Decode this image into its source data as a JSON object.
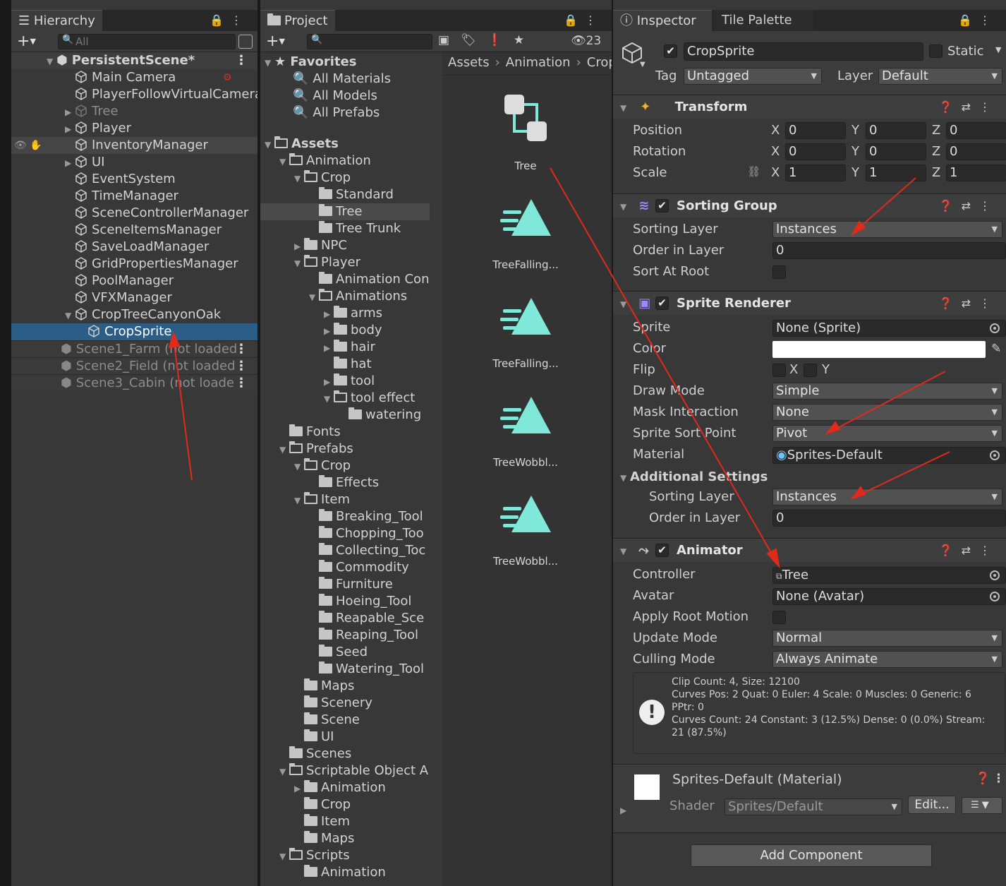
{
  "hierarchy": {
    "tab": "Hierarchy",
    "search_placeholder": "All",
    "scene": "PersistentScene*",
    "items": [
      {
        "label": "Main Camera",
        "indent": 1
      },
      {
        "label": "PlayerFollowVirtualCamera",
        "indent": 1
      },
      {
        "label": "Tree",
        "indent": 1,
        "dim": true,
        "arrow": true
      },
      {
        "label": "Player",
        "indent": 1,
        "arrow": true
      },
      {
        "label": "InventoryManager",
        "indent": 1,
        "hl": true
      },
      {
        "label": "UI",
        "indent": 1,
        "arrow": true
      },
      {
        "label": "EventSystem",
        "indent": 1
      },
      {
        "label": "TimeManager",
        "indent": 1
      },
      {
        "label": "SceneControllerManager",
        "indent": 1
      },
      {
        "label": "SceneItemsManager",
        "indent": 1
      },
      {
        "label": "SaveLoadManager",
        "indent": 1
      },
      {
        "label": "GridPropertiesManager",
        "indent": 1
      },
      {
        "label": "PoolManager",
        "indent": 1
      },
      {
        "label": "VFXManager",
        "indent": 1
      },
      {
        "label": "CropTreeCanyonOak",
        "indent": 1,
        "open": true
      },
      {
        "label": "CropSprite",
        "indent": 2,
        "sel": true
      }
    ],
    "scenes": [
      "Scene1_Farm (not loaded",
      "Scene2_Field (not loaded",
      "Scene3_Cabin (not loade"
    ]
  },
  "project": {
    "tab": "Project",
    "count": "23",
    "favorites": "Favorites",
    "fav_items": [
      "All Materials",
      "All Models",
      "All Prefabs"
    ],
    "tree": [
      {
        "label": "Assets",
        "d": 0,
        "open": true,
        "bold": true
      },
      {
        "label": "Animation",
        "d": 1,
        "open": true
      },
      {
        "label": "Crop",
        "d": 2,
        "open": true
      },
      {
        "label": "Standard",
        "d": 3
      },
      {
        "label": "Tree",
        "d": 3,
        "sel": true
      },
      {
        "label": "Tree Trunk",
        "d": 3
      },
      {
        "label": "NPC",
        "d": 2,
        "arrow": true
      },
      {
        "label": "Player",
        "d": 2,
        "open": true
      },
      {
        "label": "Animation Con",
        "d": 3
      },
      {
        "label": "Animations",
        "d": 3,
        "open": true
      },
      {
        "label": "arms",
        "d": 4,
        "arrow": true
      },
      {
        "label": "body",
        "d": 4,
        "arrow": true
      },
      {
        "label": "hair",
        "d": 4,
        "arrow": true
      },
      {
        "label": "hat",
        "d": 4
      },
      {
        "label": "tool",
        "d": 4,
        "arrow": true
      },
      {
        "label": "tool effect",
        "d": 4,
        "open": true
      },
      {
        "label": "watering",
        "d": 5
      },
      {
        "label": "Fonts",
        "d": 1
      },
      {
        "label": "Prefabs",
        "d": 1,
        "open": true
      },
      {
        "label": "Crop",
        "d": 2,
        "open": true
      },
      {
        "label": "Effects",
        "d": 3
      },
      {
        "label": "Item",
        "d": 2,
        "open": true
      },
      {
        "label": "Breaking_Tool",
        "d": 3
      },
      {
        "label": "Chopping_Too",
        "d": 3
      },
      {
        "label": "Collecting_Toc",
        "d": 3
      },
      {
        "label": "Commodity",
        "d": 3
      },
      {
        "label": "Furniture",
        "d": 3
      },
      {
        "label": "Hoeing_Tool",
        "d": 3
      },
      {
        "label": "Reapable_Sce",
        "d": 3
      },
      {
        "label": "Reaping_Tool",
        "d": 3
      },
      {
        "label": "Seed",
        "d": 3
      },
      {
        "label": "Watering_Tool",
        "d": 3
      },
      {
        "label": "Maps",
        "d": 2
      },
      {
        "label": "Scenery",
        "d": 2
      },
      {
        "label": "Scene",
        "d": 2
      },
      {
        "label": "UI",
        "d": 2
      },
      {
        "label": "Scenes",
        "d": 1
      },
      {
        "label": "Scriptable Object A",
        "d": 1,
        "open": true
      },
      {
        "label": "Animation",
        "d": 2,
        "arrow": true
      },
      {
        "label": "Crop",
        "d": 2
      },
      {
        "label": "Item",
        "d": 2
      },
      {
        "label": "Maps",
        "d": 2
      },
      {
        "label": "Scripts",
        "d": 1,
        "open": true
      },
      {
        "label": "Animation",
        "d": 2
      }
    ],
    "breadcrumb": [
      "Assets",
      "Animation",
      "Crop"
    ],
    "assets": [
      "Tree",
      "TreeFalling...",
      "TreeFalling...",
      "TreeWobbl...",
      "TreeWobbl..."
    ],
    "accent": "#7fe8d8"
  },
  "inspector": {
    "tab": "Inspector",
    "tab2": "Tile Palette",
    "name": "CropSprite",
    "static": "Static",
    "tag_label": "Tag",
    "tag": "Untagged",
    "layer_label": "Layer",
    "layer": "Default",
    "transform": {
      "title": "Transform",
      "rows": [
        {
          "label": "Position",
          "x": "0",
          "y": "0",
          "z": "0"
        },
        {
          "label": "Rotation",
          "x": "0",
          "y": "0",
          "z": "0"
        },
        {
          "label": "Scale",
          "x": "1",
          "y": "1",
          "z": "1"
        }
      ]
    },
    "sorting": {
      "title": "Sorting Group",
      "sorting_layer_label": "Sorting Layer",
      "sorting_layer": "Instances",
      "order_label": "Order in Layer",
      "order": "0",
      "root_label": "Sort At Root"
    },
    "renderer": {
      "title": "Sprite Renderer",
      "sprite_label": "Sprite",
      "sprite": "None (Sprite)",
      "color_label": "Color",
      "flip_label": "Flip",
      "draw_label": "Draw Mode",
      "draw": "Simple",
      "mask_label": "Mask Interaction",
      "mask": "None",
      "sortpoint_label": "Sprite Sort Point",
      "sortpoint": "Pivot",
      "material_label": "Material",
      "material": "Sprites-Default",
      "additional": "Additional Settings",
      "sl_label": "Sorting Layer",
      "sl": "Instances",
      "ol_label": "Order in Layer",
      "ol": "0"
    },
    "animator": {
      "title": "Animator",
      "controller_label": "Controller",
      "controller": "Tree",
      "avatar_label": "Avatar",
      "avatar": "None (Avatar)",
      "root_label": "Apply Root Motion",
      "update_label": "Update Mode",
      "update": "Normal",
      "culling_label": "Culling Mode",
      "culling": "Always Animate",
      "info": "Clip Count: 4, Size: 12100\nCurves Pos: 2 Quat: 0 Euler: 4 Scale: 0 Muscles: 0 Generic: 6\nPPtr: 0\nCurves Count: 24 Constant: 3 (12.5%) Dense: 0 (0.0%) Stream:\n21 (87.5%)"
    },
    "material": {
      "title": "Sprites-Default (Material)",
      "shader_label": "Shader",
      "shader": "Sprites/Default",
      "edit": "Edit..."
    },
    "add_component": "Add Component"
  }
}
